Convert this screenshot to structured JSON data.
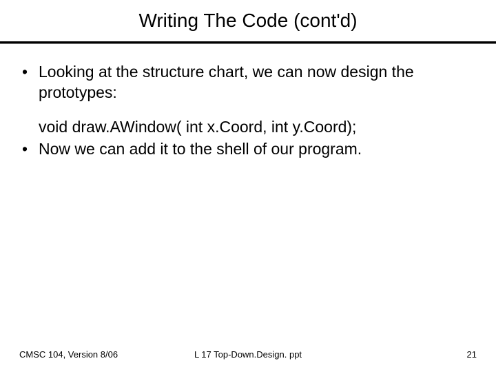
{
  "title": "Writing The Code (cont'd)",
  "bullets": {
    "b1": "Looking at the structure chart, we can now design the prototypes:",
    "code": "void draw.AWindow( int x.Coord, int y.Coord);",
    "b2": "Now we can add it to the shell of our program."
  },
  "footer": {
    "left": "CMSC 104, Version 8/06",
    "center": "L 17 Top-Down.Design. ppt",
    "right": "21"
  }
}
